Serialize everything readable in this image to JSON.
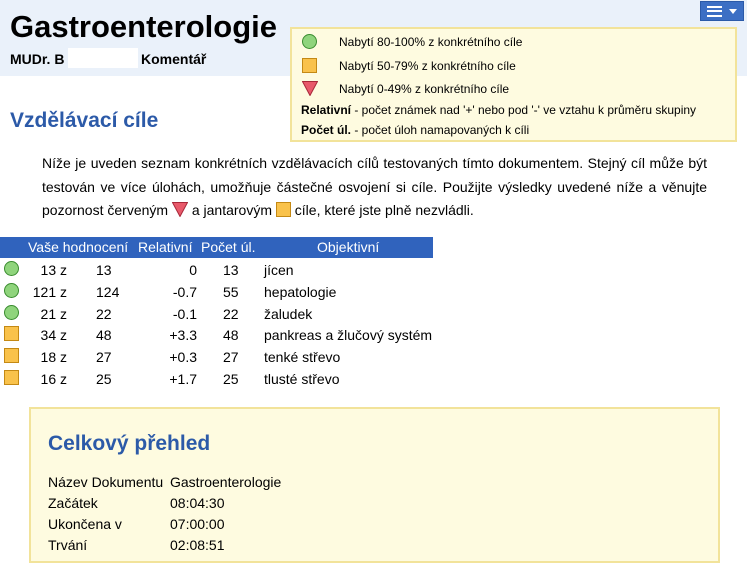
{
  "header": {
    "title": "Gastroenterologie",
    "student": "MUDr. B",
    "comment_label": "Komentář",
    "menu_icon": "hamburger-menu-icon"
  },
  "legend": {
    "items": [
      {
        "icon": "green-circle-icon",
        "label": "Nabytí 80-100% z konkrétního cíle"
      },
      {
        "icon": "amber-square-icon",
        "label": "Nabytí 50-79% z konkrétního cíle"
      },
      {
        "icon": "red-triangle-icon",
        "label": "Nabytí 0-49% z konkrétního cíle"
      }
    ],
    "relative_term": "Relativní",
    "relative_desc": " - počet známek nad '+' nebo pod '-' ve vztahu k průměru skupiny",
    "count_term": "Počet úl.",
    "count_desc": " - počet úloh namapovaných k cíli"
  },
  "objectives": {
    "title": "Vzdělávací cíle",
    "intro_1": "Níže je uveden seznam konkrétních vzdělávacích cílů testovaných tímto dokumentem. Stejný cíl může být testován ve více úlohách, umožňuje částečné osvojení si cíle. Použijte výsledky uvedené níže a věnujte pozornost červeným ",
    "intro_2": " a jantarovým ",
    "intro_3": " cíle, které jste plně nezvládli.",
    "columns": {
      "score": "Vaše hodnocení",
      "relative": "Relativní",
      "count": "Počet úl.",
      "objective": "Objektivní"
    },
    "rows": [
      {
        "status": "green",
        "score": "13 z",
        "total": "13",
        "relative": "0",
        "count": "13",
        "objective": "jícen"
      },
      {
        "status": "green",
        "score": "121 z",
        "total": "124",
        "relative": "-0.7",
        "count": "55",
        "objective": "hepatologie"
      },
      {
        "status": "green",
        "score": "21 z",
        "total": "22",
        "relative": "-0.1",
        "count": "22",
        "objective": "žaludek"
      },
      {
        "status": "amber",
        "score": "34 z",
        "total": "48",
        "relative": "+3.3",
        "count": "48",
        "objective": "pankreas a žlučový systém"
      },
      {
        "status": "amber",
        "score": "18 z",
        "total": "27",
        "relative": "+0.3",
        "count": "27",
        "objective": "tenké střevo"
      },
      {
        "status": "amber",
        "score": "16 z",
        "total": "25",
        "relative": "+1.7",
        "count": "25",
        "objective": "tlusté střevo"
      }
    ]
  },
  "summary": {
    "title": "Celkový přehled",
    "rows": [
      {
        "label": "Název Dokumentu",
        "value": "Gastroenterologie"
      },
      {
        "label": "Začátek",
        "value": "08:04:30"
      },
      {
        "label": "Ukončena v",
        "value": "07:00:00"
      },
      {
        "label": "Trvání",
        "value": "02:08:51"
      }
    ]
  },
  "colors": {
    "accent": "#2c5aa8",
    "table_header": "#3063bd",
    "green": "#8fd47c",
    "amber": "#f9c24b",
    "red": "#e8596a",
    "panel_bg": "#fefbe0",
    "panel_border": "#f2e39a"
  }
}
